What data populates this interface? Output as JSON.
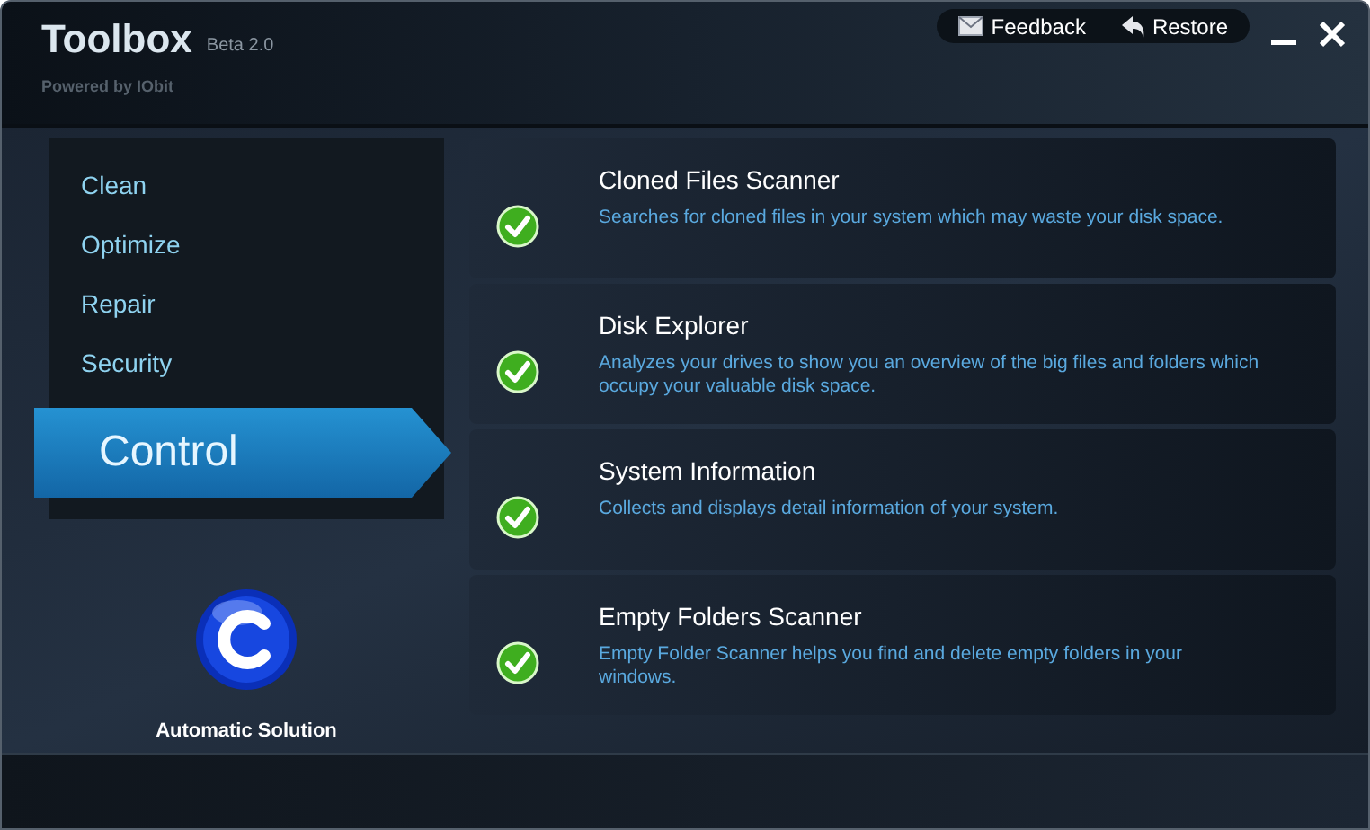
{
  "window": {
    "title": "Toolbox",
    "version": "Beta 2.0",
    "subtitle": "Powered by IObit"
  },
  "header_links": [
    {
      "kind": "feedback",
      "label": "Feedback"
    },
    {
      "kind": "restore",
      "label": "Restore"
    }
  ],
  "sidebar": {
    "items": [
      {
        "label": "Clean",
        "selected": false
      },
      {
        "label": "Optimize",
        "selected": false
      },
      {
        "label": "Repair",
        "selected": false
      },
      {
        "label": "Security",
        "selected": false
      },
      {
        "label": "Control",
        "selected": true
      }
    ],
    "badge_label": "Automatic Solution"
  },
  "tools": [
    {
      "name": "Cloned Files Scanner",
      "description": "Searches for cloned files in your system which may waste your disk space.",
      "checked": true
    },
    {
      "name": "Disk Explorer",
      "description": "Analyzes your drives to show you an overview of the big files and folders which occupy your valuable disk space.",
      "checked": true
    },
    {
      "name": "System Information",
      "description": "Collects and displays detail information of your system.",
      "checked": true
    },
    {
      "name": "Empty Folders Scanner",
      "description": "Empty Folder Scanner helps you find and delete empty folders in your windows.",
      "checked": true
    }
  ]
}
